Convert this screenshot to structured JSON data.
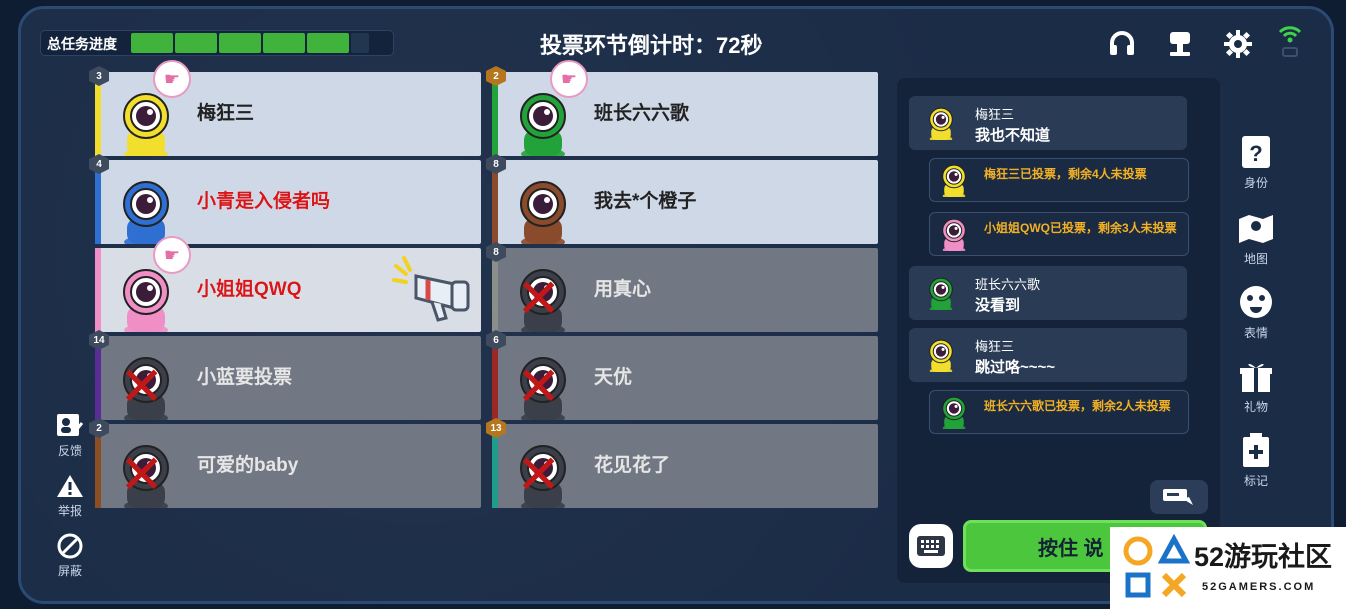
{
  "header": {
    "progress_label": "总任务进度",
    "progress_fraction": 0.75,
    "progress_segments_total": 6,
    "progress_segments_filled": 5,
    "timer_text": "投票环节倒计时：72秒"
  },
  "top_icons": [
    "headset-icon",
    "podium-icon",
    "gear-icon",
    "wifi-signal-icon"
  ],
  "players": [
    {
      "badge": "3",
      "name": "梅狂三",
      "color": "#f2de2c",
      "status": "alive",
      "voted": true,
      "name_red": false
    },
    {
      "badge": "2",
      "name": "班长六六歌",
      "color": "#22a33a",
      "status": "alive",
      "voted": true,
      "name_red": false,
      "gold": true
    },
    {
      "badge": "4",
      "name": "小青是入侵者吗",
      "color": "#2f6fd1",
      "status": "alive",
      "voted": false,
      "name_red": true
    },
    {
      "badge": "8",
      "name": "我去*个橙子",
      "color": "#8a4a2c",
      "status": "alive",
      "voted": false,
      "name_red": false
    },
    {
      "badge": "",
      "name": "小姐姐QWQ",
      "color": "#ef8fc6",
      "status": "alive",
      "voted": true,
      "name_red": true,
      "speaking": true
    },
    {
      "badge": "8",
      "name": "用真心",
      "color": "#8b8f8a",
      "status": "dead",
      "voted": false,
      "name_red": false
    },
    {
      "badge": "14",
      "name": "小蓝要投票",
      "color": "#5a2c96",
      "status": "dead",
      "voted": false,
      "name_red": false
    },
    {
      "badge": "6",
      "name": "天优",
      "color": "#9c2727",
      "status": "dead",
      "voted": false,
      "name_red": false
    },
    {
      "badge": "2",
      "name": "可爱的baby",
      "color": "#8d4f22",
      "status": "dead",
      "voted": false,
      "name_red": false
    },
    {
      "badge": "13",
      "name": "花见花了",
      "color": "#1f9c8a",
      "status": "dead",
      "voted": false,
      "name_red": false,
      "gold": true
    }
  ],
  "chat": [
    {
      "type": "msg",
      "name": "梅狂三",
      "text": "我也不知道",
      "color": "#f2de2c"
    },
    {
      "type": "sys",
      "text": "梅狂三已投票，剩余4人未投票",
      "color": "#f2de2c"
    },
    {
      "type": "sys",
      "text": "小姐姐QWQ已投票，剩余3人未投票",
      "color": "#ef8fc6"
    },
    {
      "type": "msg",
      "name": "班长六六歌",
      "text": "没看到",
      "color": "#22a33a"
    },
    {
      "type": "msg",
      "name": "梅狂三",
      "text": "跳过咯~~~~",
      "color": "#f2de2c"
    },
    {
      "type": "sys",
      "text": "班长六六歌已投票，剩余2人未投票",
      "color": "#22a33a"
    }
  ],
  "sidebar": [
    {
      "label": "身份",
      "icon": "identity-card-icon"
    },
    {
      "label": "地图",
      "icon": "map-icon"
    },
    {
      "label": "表情",
      "icon": "emoji-icon"
    },
    {
      "label": "礼物",
      "icon": "gift-icon"
    },
    {
      "label": "标记",
      "icon": "mark-icon"
    }
  ],
  "left_tools": [
    {
      "label": "反馈",
      "icon": "feedback-icon"
    },
    {
      "label": "举报",
      "icon": "warning-icon"
    },
    {
      "label": "屏蔽",
      "icon": "block-icon"
    }
  ],
  "talk_button": "按住 说",
  "logo": {
    "big": "52游玩社区",
    "small": "52GAMERS.COM"
  }
}
